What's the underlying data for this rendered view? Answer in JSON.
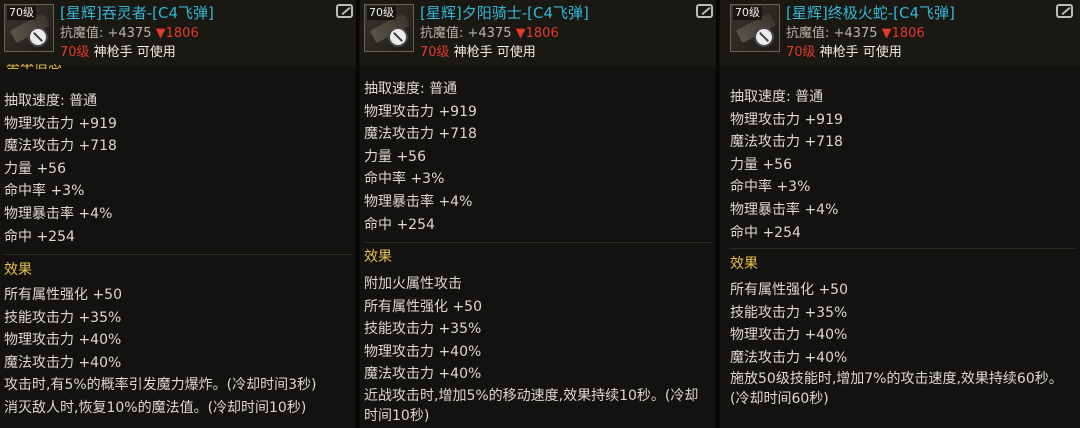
{
  "panels": [
    {
      "level_badge": "70级",
      "title_tag": "[星辉]",
      "title_name": "吞灵者-[C4飞弹]",
      "resist_label": "抗魔值: +4375",
      "resist_delta": "▼1806",
      "req_level": "70级",
      "req_class": " 神枪手 可使用",
      "cut_header": "基本信息",
      "stats": [
        "抽取速度: 普通",
        "物理攻击力 +919",
        "魔法攻击力 +718",
        "力量 +56",
        "命中率 +3%",
        "物理暴击率 +4%",
        "命中 +254"
      ],
      "effect_title": "效果",
      "effects": [
        "所有属性强化 +50",
        "技能攻击力 +35%",
        "物理攻击力 +40%",
        "魔法攻击力 +40%",
        "攻击时,有5%的概率引发魔力爆炸。(冷却时间3秒)",
        "消灭敌人时,恢复10%的魔法值。(冷却时间10秒)"
      ]
    },
    {
      "level_badge": "70级",
      "title_tag": "[星辉]",
      "title_name": "夕阳骑士-[C4飞弹]",
      "resist_label": "抗魔值: +4375",
      "resist_delta": "▼1806",
      "req_level": "70级",
      "req_class": " 神枪手 可使用",
      "stats": [
        "抽取速度: 普通",
        "物理攻击力 +919",
        "魔法攻击力 +718",
        "力量 +56",
        "命中率 +3%",
        "物理暴击率 +4%",
        "命中 +254"
      ],
      "effect_title": "效果",
      "effects": [
        "附加火属性攻击",
        "所有属性强化 +50",
        "技能攻击力 +35%",
        "物理攻击力 +40%",
        "魔法攻击力 +40%"
      ],
      "effect_long": "近战攻击时,增加5%的移动速度,效果持续10秒。(冷却时间10秒)"
    },
    {
      "level_badge": "70级",
      "title_tag": "[星辉]",
      "title_name": "终极火蛇-[C4飞弹]",
      "resist_label": "抗魔值: +4375",
      "resist_delta": "▼1806",
      "req_level": "70级",
      "req_class": " 神枪手 可使用",
      "stats": [
        "抽取速度: 普通",
        "物理攻击力 +919",
        "魔法攻击力 +718",
        "力量 +56",
        "命中率 +3%",
        "物理暴击率 +4%",
        "命中 +254"
      ],
      "effect_title": "效果",
      "effects": [
        "所有属性强化 +50",
        "技能攻击力 +35%",
        "物理攻击力 +40%",
        "魔法攻击力 +40%"
      ],
      "effect_long": "施放50级技能时,增加7%的攻击速度,效果持续60秒。(冷却时间60秒)"
    }
  ],
  "colors": {
    "title": "#35b6d6",
    "down": "#e03a2c",
    "effect_title": "#e6c24a"
  }
}
